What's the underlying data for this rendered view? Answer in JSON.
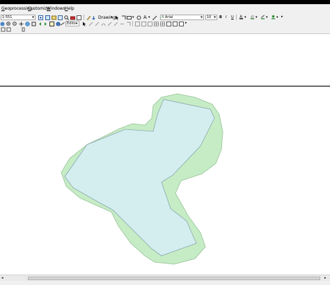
{
  "menu": {
    "items": [
      "Geoprocessing",
      "Customize",
      "Windows",
      "Help"
    ]
  },
  "toolbar": {
    "scale_value": "1:551",
    "drawing_label": "Drawing",
    "font_name": "Arial",
    "font_size": "10",
    "bold": "B",
    "italic": "I",
    "underline": "U",
    "text_tool": "A",
    "editor_label": "Editor"
  },
  "colors": {
    "buffer_fill": "#c6ecc6",
    "buffer_stroke": "#a3cba3",
    "polygon_fill": "#d4eef0",
    "polygon_stroke": "#8aa6ad",
    "toolbar_bg": "#f0f0f0"
  },
  "icons": [
    "open-icon",
    "save-icon",
    "print-icon",
    "cut-icon",
    "copy-icon",
    "paste-icon",
    "delete-icon",
    "undo-icon",
    "redo-icon",
    "add-data-icon",
    "zoom-in-icon",
    "zoom-out-icon",
    "pan-icon",
    "full-extent-icon",
    "identify-icon",
    "select-icon",
    "measure-icon",
    "pointer-icon",
    "rectangle-icon",
    "text-icon",
    "bold-icon",
    "italic-icon",
    "underline-icon",
    "font-color-icon",
    "fill-color-icon",
    "line-color-icon",
    "marker-color-icon"
  ]
}
